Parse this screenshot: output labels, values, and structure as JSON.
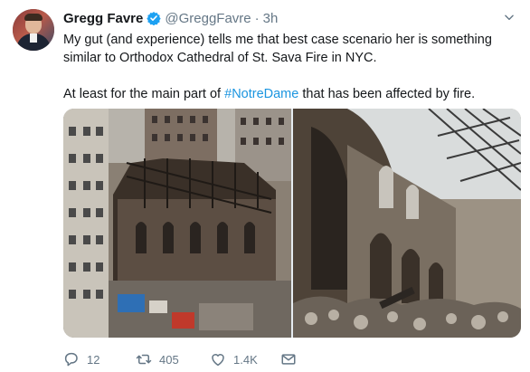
{
  "tweet": {
    "author_name": "Gregg Favre",
    "handle": "@GreggFavre",
    "separator": "·",
    "time": "3h",
    "text_line1": "My gut (and experience) tells me that best case scenario her is something similar to Orthodox Cathedral of St. Sava Fire in NYC.",
    "text_line2_prefix": "At least for the main part of ",
    "hashtag": "#NotreDame",
    "text_line2_suffix": " that has been affected by fire."
  },
  "actions": {
    "replies": "12",
    "retweets": "405",
    "likes": "1.4K"
  },
  "colors": {
    "link": "#1b95e0",
    "text": "#14171a",
    "secondary": "#657786",
    "verified": "#1da1f2"
  },
  "icons": [
    "verified-badge-icon",
    "chevron-down-icon",
    "reply-icon",
    "retweet-icon",
    "like-icon",
    "direct-message-icon"
  ]
}
